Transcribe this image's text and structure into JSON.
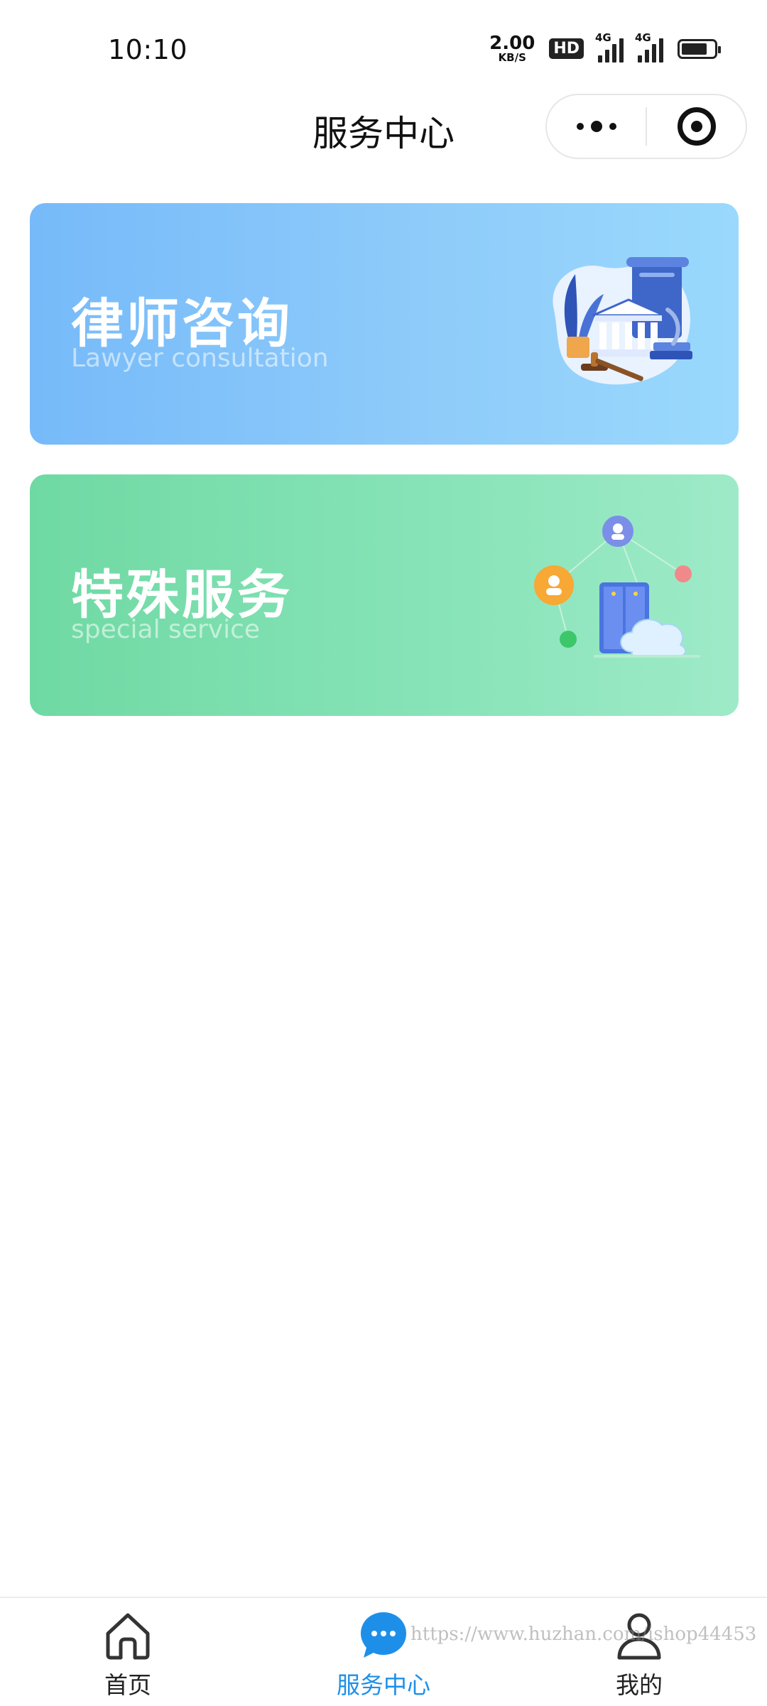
{
  "status_bar": {
    "time": "10:10",
    "net_speed_value": "2.00",
    "net_speed_unit": "KB/S",
    "hd_label": "HD",
    "signal_1_label": "4G",
    "signal_2_label": "4G"
  },
  "nav": {
    "title": "服务中心"
  },
  "cards": [
    {
      "title": "律师咨询",
      "subtitle": "Lawyer consultation",
      "icon": "lawyer-illustration"
    },
    {
      "title": "特殊服务",
      "subtitle": "special service",
      "icon": "special-service-illustration"
    }
  ],
  "tabbar": {
    "items": [
      {
        "label": "首页",
        "icon": "home-icon",
        "active": false
      },
      {
        "label": "服务中心",
        "icon": "chat-bubble-icon",
        "active": true
      },
      {
        "label": "我的",
        "icon": "user-icon",
        "active": false
      }
    ],
    "active_color": "#1e8fe8"
  },
  "watermark": "https://www.huzhan.com/ishop44453",
  "colors": {
    "lawyer_card": "#8ecbfa",
    "special_card": "#86e3b7"
  }
}
